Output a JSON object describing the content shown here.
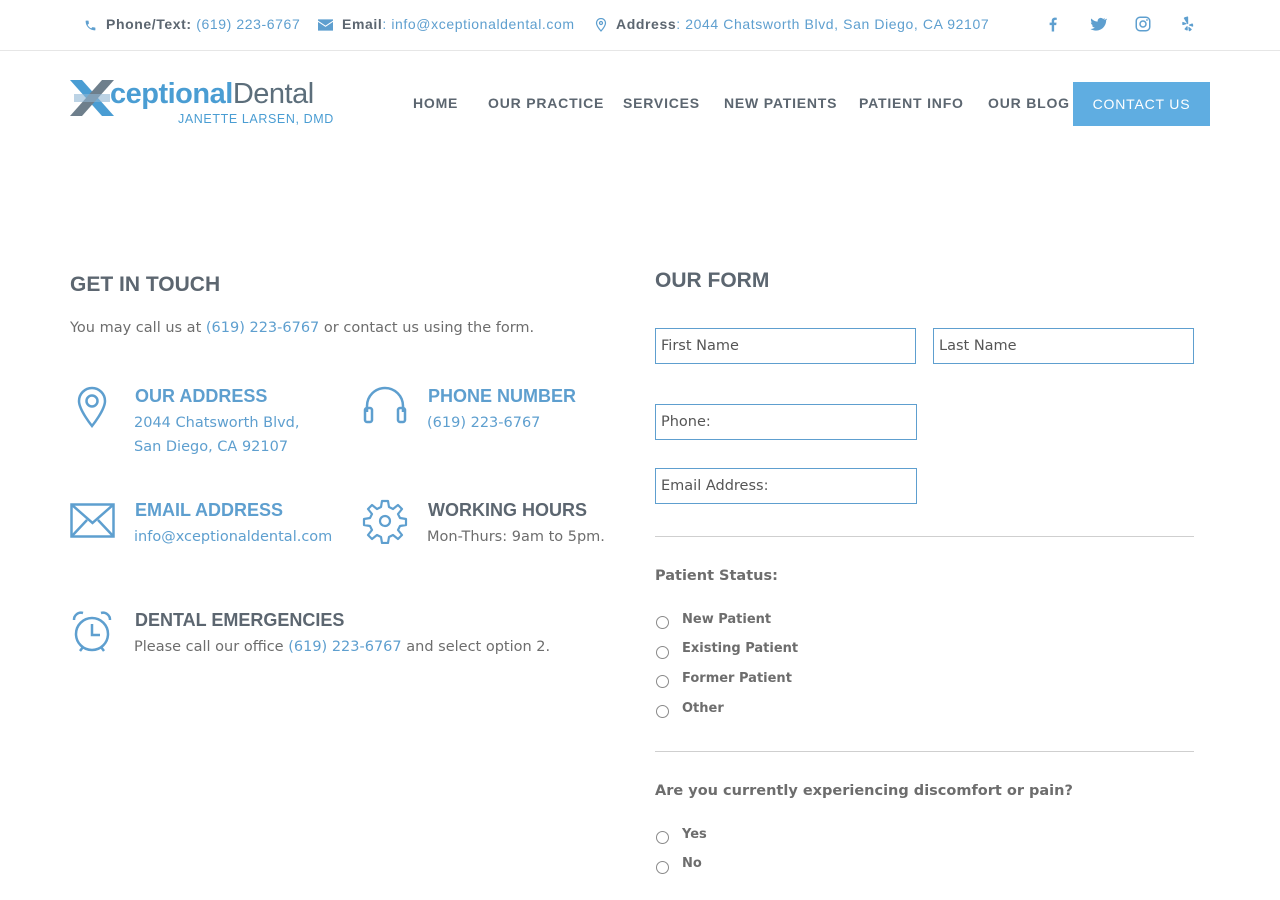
{
  "topbar": {
    "phone_label": "Phone/Text:",
    "phone_value": "(619) 223-6767",
    "email_label": "Email",
    "email_value": ": info@xceptionaldental.com",
    "address_label": "Address",
    "address_value": ": 2044 Chatsworth Blvd, San Diego, CA 92107",
    "social": [
      "facebook-icon",
      "twitter-icon",
      "instagram-icon",
      "yelp-icon"
    ]
  },
  "logo": {
    "part1": "ceptional",
    "part2": "Dental",
    "subtitle": "JANETTE LARSEN, DMD"
  },
  "nav": {
    "items": [
      "HOME",
      "OUR PRACTICE",
      "SERVICES",
      "NEW PATIENTS",
      "PATIENT INFO",
      "OUR BLOG"
    ],
    "cta": "CONTACT US"
  },
  "contact": {
    "title": "GET IN TOUCH",
    "intro_pre": "You may call us at ",
    "intro_phone": "(619) 223-6767",
    "intro_post": " or contact us using the form.",
    "address": {
      "title": "OUR ADDRESS",
      "line1": "2044 Chatsworth Blvd,",
      "line2": "San Diego, CA 92107"
    },
    "phone": {
      "title": "PHONE NUMBER",
      "value": "(619) 223-6767"
    },
    "email": {
      "title": "EMAIL ADDRESS",
      "value": "info@xceptionaldental.com"
    },
    "hours": {
      "title": "WORKING HOURS",
      "value": "Mon-Thurs: 9am to 5pm."
    },
    "emergency": {
      "title": "DENTAL EMERGENCIES",
      "pre": "Please call our office ",
      "phone": "(619) 223-6767",
      "post": " and select option 2."
    }
  },
  "form": {
    "title": "OUR FORM",
    "first_name": "First Name",
    "last_name": "Last Name",
    "phone": "Phone:",
    "email": "Email Address:",
    "status_label": "Patient Status:",
    "status_options": [
      "New Patient",
      "Existing Patient",
      "Former Patient",
      "Other"
    ],
    "pain_label": "Are you currently experiencing discomfort or pain?",
    "pain_options": [
      "Yes",
      "No"
    ]
  },
  "colors": {
    "accent": "#5fade1",
    "link": "#5e9fcf",
    "heading": "#5c6670"
  }
}
